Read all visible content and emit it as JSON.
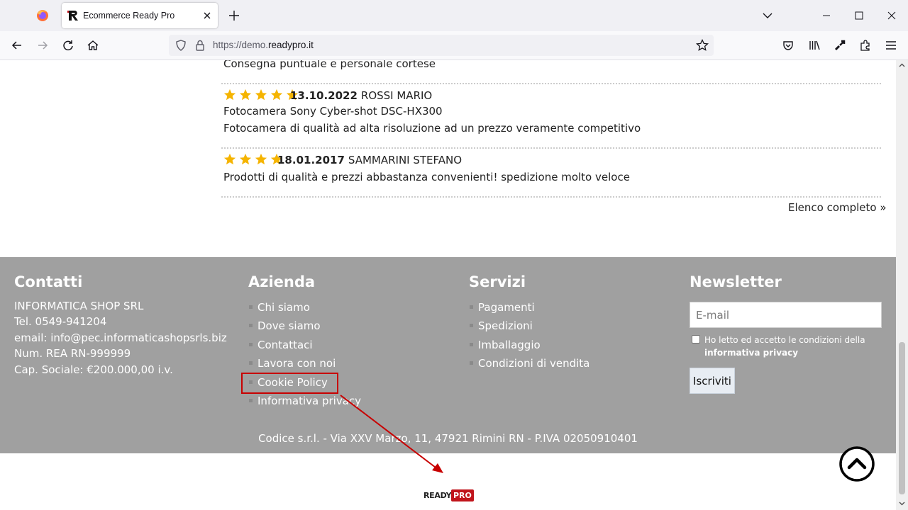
{
  "browser": {
    "tab_title": "Ecommerce Ready Pro",
    "url_prefix": "https://demo.",
    "url_domain": "readypro.it"
  },
  "reviews": {
    "prev_comment": "Consegna puntuale e personale cortese",
    "items": [
      {
        "stars": 5,
        "date": "13.10.2022",
        "author": "ROSSI MARIO",
        "product": "Fotocamera Sony Cyber-shot DSC-HX300",
        "comment": "Fotocamera di qualità ad alta risoluzione ad un prezzo veramente competitivo"
      },
      {
        "stars": 4,
        "date": "18.01.2017",
        "author": "SAMMARINI STEFANO",
        "comment": "Prodotti di qualità e prezzi abbastanza convenienti! spedizione molto veloce"
      }
    ],
    "full_list_link": "Elenco completo »"
  },
  "footer": {
    "contacts": {
      "title": "Contatti",
      "lines": [
        "INFORMATICA SHOP SRL",
        "Tel. 0549-941204",
        "email: info@pec.informaticashopsrls.biz",
        "Num. REA RN-999999",
        "Cap. Sociale: €200.000,00 i.v."
      ]
    },
    "company": {
      "title": "Azienda",
      "links": [
        "Chi siamo",
        "Dove siamo",
        "Contattaci",
        "Lavora con noi",
        "Cookie Policy",
        "Informativa privacy"
      ]
    },
    "services": {
      "title": "Servizi",
      "links": [
        "Pagamenti",
        "Spedizioni",
        "Imballaggio",
        "Condizioni di vendita"
      ]
    },
    "newsletter": {
      "title": "Newsletter",
      "email_placeholder": "E-mail",
      "consent_text": "Ho letto ed accetto le condizioni della",
      "consent_link": "informativa privacy",
      "subscribe_label": "Iscriviti"
    },
    "address": "Codice s.r.l. - Via XXV Marzo, 11, 47921 Rimini RN - P.IVA 02050910401"
  },
  "logo": {
    "ready": "READY",
    "pro": "PRO"
  },
  "colors": {
    "star": "#f5b400",
    "footer_bg": "#a0a0a0",
    "highlight": "#c80000"
  }
}
